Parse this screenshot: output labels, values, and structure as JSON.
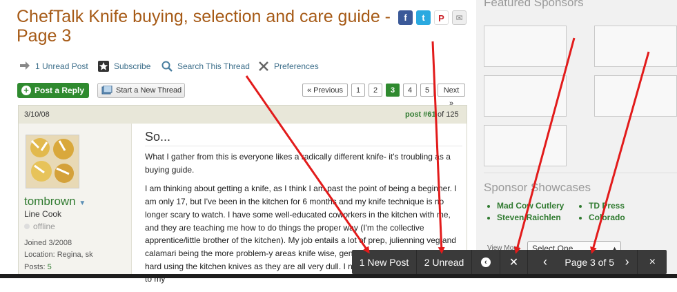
{
  "title": "ChefTalk Knife buying, selection and care guide - Page 3",
  "toolbar": {
    "unread_post": "1 Unread Post",
    "subscribe": "Subscribe",
    "search_thread": "Search This Thread",
    "preferences": "Preferences"
  },
  "buttons": {
    "post_reply": "Post a Reply",
    "new_thread": "Start a New Thread"
  },
  "pagination": {
    "previous": "« Previous",
    "pages": [
      "1",
      "2",
      "3",
      "4",
      "5"
    ],
    "current": "3",
    "next": "Next »"
  },
  "post": {
    "date": "3/10/08",
    "post_number_label": "post #61",
    "of_total": "of 125",
    "subject": "So...",
    "paragraph1": "What I gather from this is everyone likes a radically different knife- it's troubling as a buying guide.",
    "paragraph2": "I am thinking about getting a knife, as I think I am past the point of being a beginner. I am only 17, but I've been in the kitchen for 6 months and my knife technique is no longer scary to watch. I have some well-educated coworkers in the kitchen with me, and they are teaching me how to do things the proper way (I'm the collective apprentice/little brother of the kitchen). My job entails a lot of prep, julienning veg and calamari being the more problem-y areas knife wise, general cutting, and I find it very hard using the kitchen knives as they are all very dull. I need a knife that is agile but not to my"
  },
  "user": {
    "username": "tombrown",
    "rank": "Line Cook",
    "status": "offline",
    "joined": "Joined 3/2008",
    "location": "Location: Regina, sk",
    "posts_label": "Posts:",
    "posts_count": "5"
  },
  "sidebar": {
    "featured_title": "Featured Sponsors",
    "showcase_title": "Sponsor Showcases",
    "showcase_links": [
      "Mad Cow Cutlery",
      "Steven Raichlen",
      "TD Press",
      "Colorado"
    ],
    "view_more": "View More",
    "select_one": "Select One"
  },
  "bottom_bar": {
    "new_post": "1 New Post",
    "unread": "2 Unread",
    "page_label": "Page 3 of 5",
    "close": "×"
  },
  "colors": {
    "title": "#a65a16",
    "accent_green": "#2f8a2f",
    "link_blue": "#3c6e8a",
    "arrow_red": "#e21b1b",
    "bottom_bar": "#3a3a3a"
  }
}
